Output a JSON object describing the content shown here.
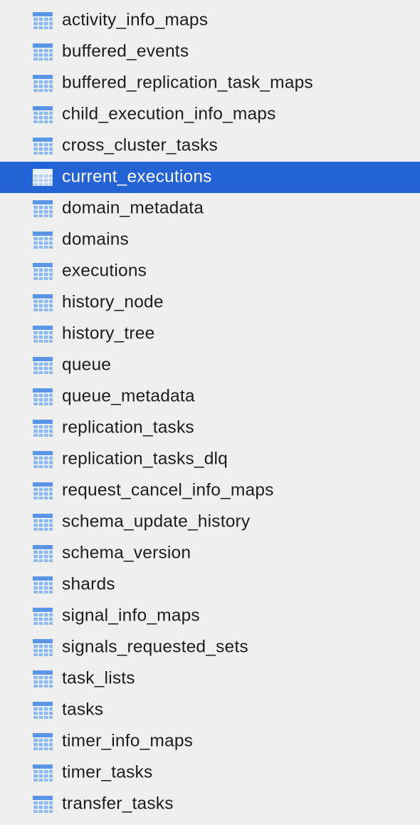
{
  "colors": {
    "background": "#efefef",
    "selection": "#2463d6",
    "text": "#1d1d1d",
    "selected_text": "#ffffff",
    "icon_header": "#5a95e6",
    "icon_cell": "#8db9ee"
  },
  "table_icon": "table-grid-icon",
  "selected_index": 5,
  "tables": [
    "activity_info_maps",
    "buffered_events",
    "buffered_replication_task_maps",
    "child_execution_info_maps",
    "cross_cluster_tasks",
    "current_executions",
    "domain_metadata",
    "domains",
    "executions",
    "history_node",
    "history_tree",
    "queue",
    "queue_metadata",
    "replication_tasks",
    "replication_tasks_dlq",
    "request_cancel_info_maps",
    "schema_update_history",
    "schema_version",
    "shards",
    "signal_info_maps",
    "signals_requested_sets",
    "task_lists",
    "tasks",
    "timer_info_maps",
    "timer_tasks",
    "transfer_tasks"
  ]
}
